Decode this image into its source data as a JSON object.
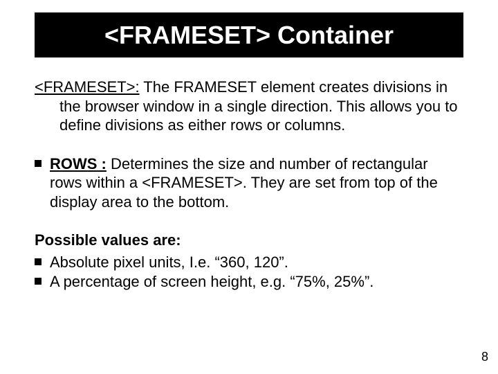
{
  "title": "<FRAMESET> Container",
  "p1": {
    "lead": "<FRAMESET>:",
    "text": " The FRAMESET element creates divisions in the browser window in a single direction. This allows you to define divisions as either rows or columns."
  },
  "p2": {
    "lead": "ROWS :",
    "text": " Determines the size and number of rectangular rows within a <FRAMESET>. They are set from top of the display area to the bottom."
  },
  "pv": {
    "head": "Possible values are:",
    "items": [
      "Absolute pixel units, I.e. “360, 120”.",
      "A percentage of screen height, e.g. “75%, 25%”."
    ]
  },
  "page": "8"
}
